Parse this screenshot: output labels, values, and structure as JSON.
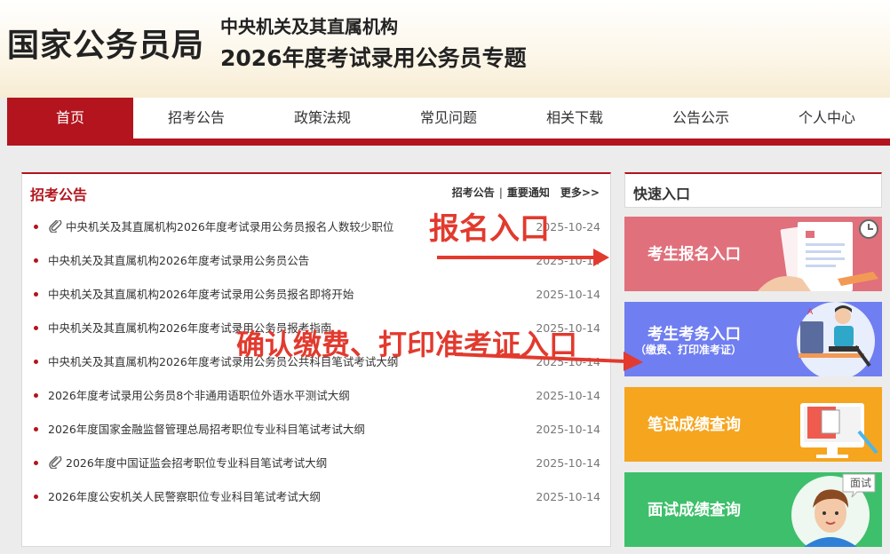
{
  "header": {
    "logo": "国家公务员局",
    "subtitle": "中央机关及其直属机构",
    "title": "2026年度考试录用公务员专题"
  },
  "nav": {
    "items": [
      "首页",
      "招考公告",
      "政策法规",
      "常见问题",
      "相关下载",
      "公告公示",
      "个人中心"
    ],
    "active_index": 0
  },
  "notice": {
    "title": "招考公告",
    "links": {
      "a": "招考公告",
      "sep": "|",
      "b": "重要通知",
      "more": "更多>>"
    },
    "items": [
      {
        "text": "中央机关及其直属机构2026年度考试录用公务员报名人数较少职位",
        "date": "2025-10-24",
        "attachment": true
      },
      {
        "text": "中央机关及其直属机构2026年度考试录用公务员公告",
        "date": "2025-10-14",
        "attachment": false
      },
      {
        "text": "中央机关及其直属机构2026年度考试录用公务员报名即将开始",
        "date": "2025-10-14",
        "attachment": false
      },
      {
        "text": "中央机关及其直属机构2026年度考试录用公务员报考指南",
        "date": "2025-10-14",
        "attachment": false
      },
      {
        "text": "中央机关及其直属机构2026年度考试录用公务员公共科目笔试考试大纲",
        "date": "2025-10-14",
        "attachment": false
      },
      {
        "text": "2026年度考试录用公务员8个非通用语职位外语水平测试大纲",
        "date": "2025-10-14",
        "attachment": false
      },
      {
        "text": "2026年度国家金融监督管理总局招考职位专业科目笔试考试大纲",
        "date": "2025-10-14",
        "attachment": false
      },
      {
        "text": "2026年度中国证监会招考职位专业科目笔试考试大纲",
        "date": "2025-10-14",
        "attachment": true
      },
      {
        "text": "2026年度公安机关人民警察职位专业科目笔试考试大纲",
        "date": "2025-10-14",
        "attachment": false
      }
    ]
  },
  "quick": {
    "title": "快速入口",
    "cards": [
      {
        "label": "考生报名入口",
        "sub": "",
        "color": "#e0707b"
      },
      {
        "label": "考生考务入口",
        "sub": "（缴费、打印准考证）",
        "color": "#6f7ef0"
      },
      {
        "label": "笔试成绩查询",
        "sub": "",
        "color": "#f6a51f"
      },
      {
        "label": "面试成绩查询",
        "sub": "",
        "color": "#3ebf6b",
        "badge": "面试"
      }
    ]
  },
  "annotations": {
    "signup": "报名入口",
    "payment": "确认缴费、打印准考证入口"
  },
  "colors": {
    "brand": "#b3141d",
    "annotation": "#e23a2e"
  }
}
